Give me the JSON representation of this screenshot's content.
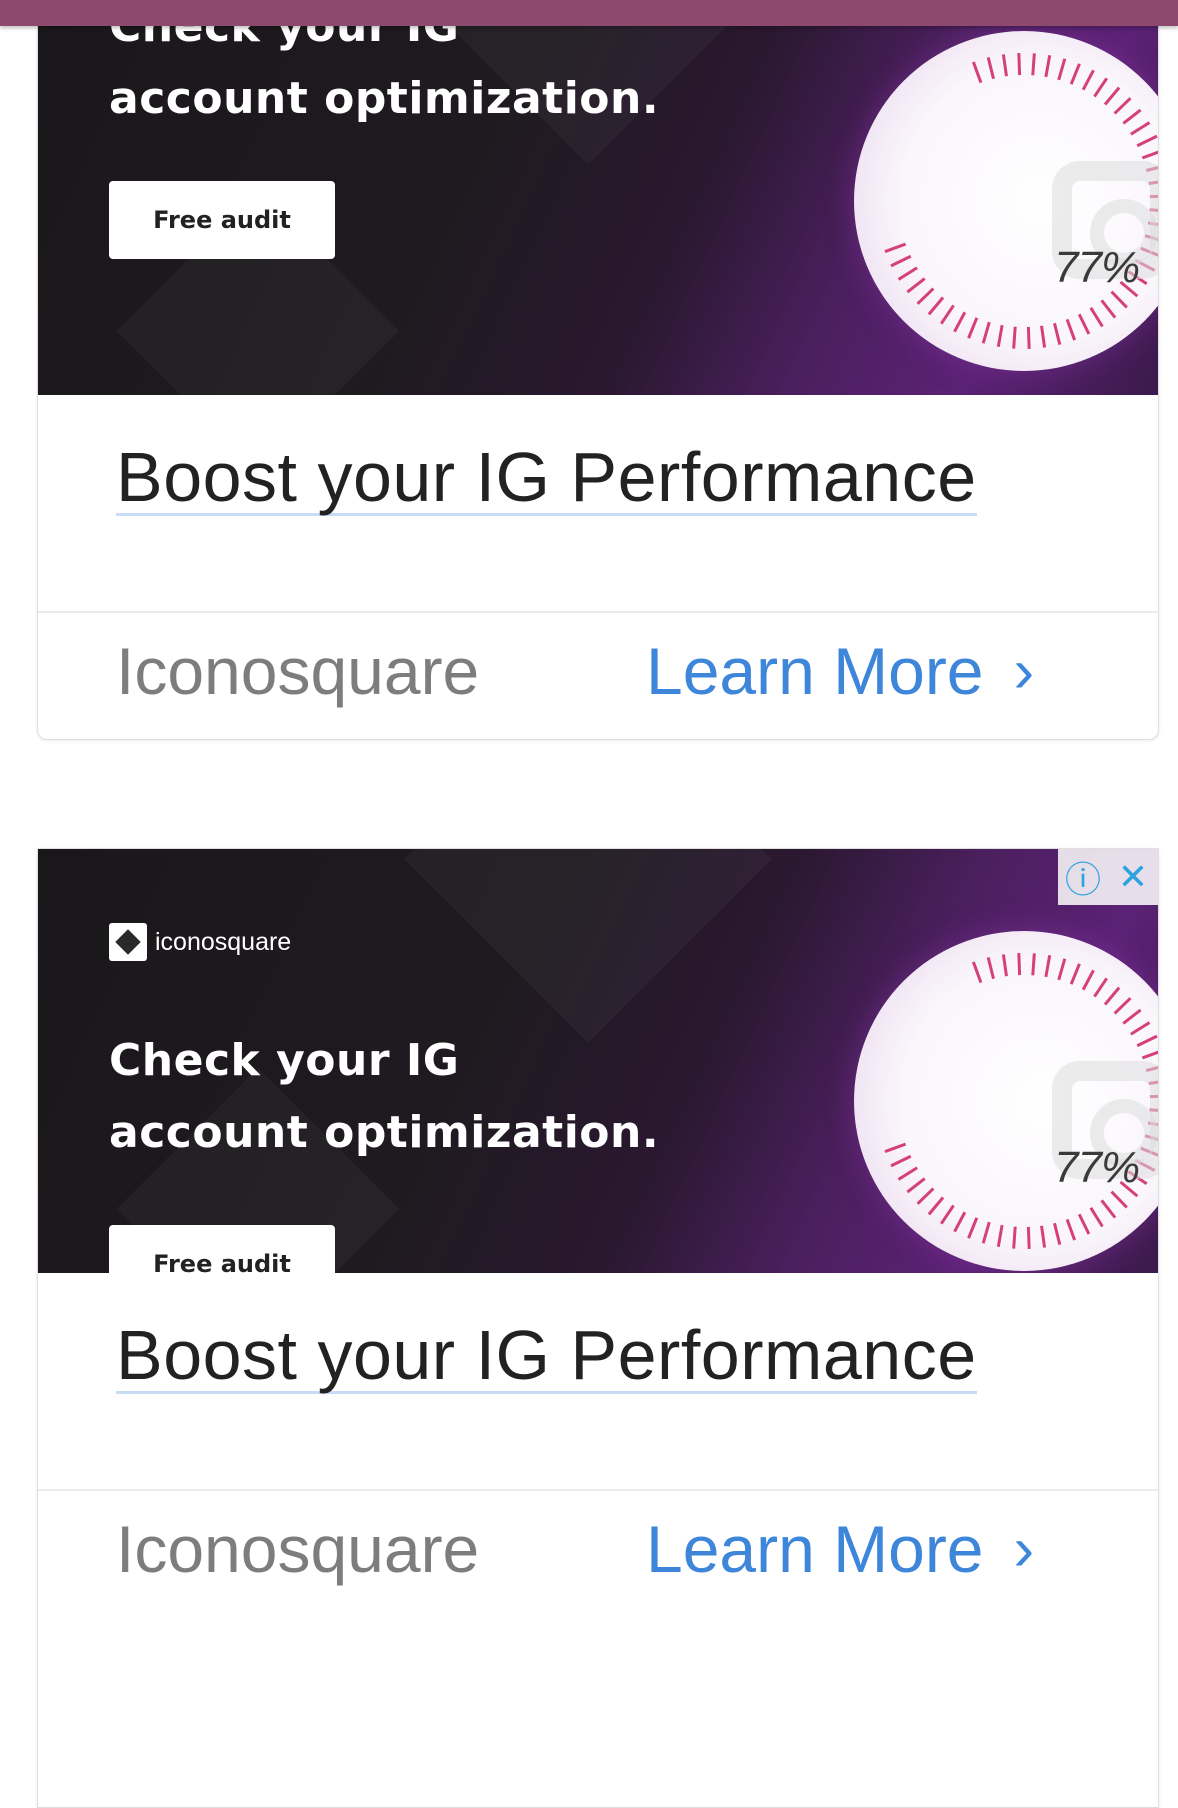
{
  "ad": {
    "brand_name": "iconosquare",
    "headline_line1": "Check your IG",
    "headline_line2": "account optimization.",
    "cta_button": "Free audit",
    "gauge_percent": "77%",
    "title": "Boost your IG Performance",
    "advertiser": "Iconosquare",
    "learn_more": "Learn More",
    "chevron": "›",
    "info_icon": "ⓘ",
    "close_icon": "✕"
  },
  "colors": {
    "top_bar": "#8e4a6e",
    "link": "#3e86d9",
    "ad_choices": "#2aa3e0"
  }
}
